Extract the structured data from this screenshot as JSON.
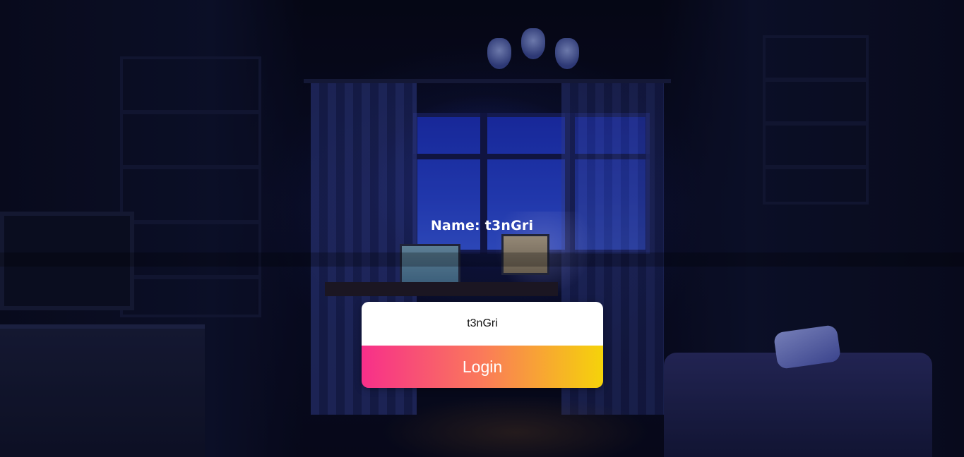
{
  "profile": {
    "name_label": "Name: t3nGri"
  },
  "login_form": {
    "username_value": "t3nGri",
    "login_label": "Login"
  },
  "colors": {
    "button_gradient_start": "#f72f8a",
    "button_gradient_mid": "#fa7a5a",
    "button_gradient_end": "#f5d30a",
    "input_background": "#ffffff",
    "background_dark": "#05061a"
  },
  "background": {
    "scene": "dark-bedroom-night-illustration"
  }
}
